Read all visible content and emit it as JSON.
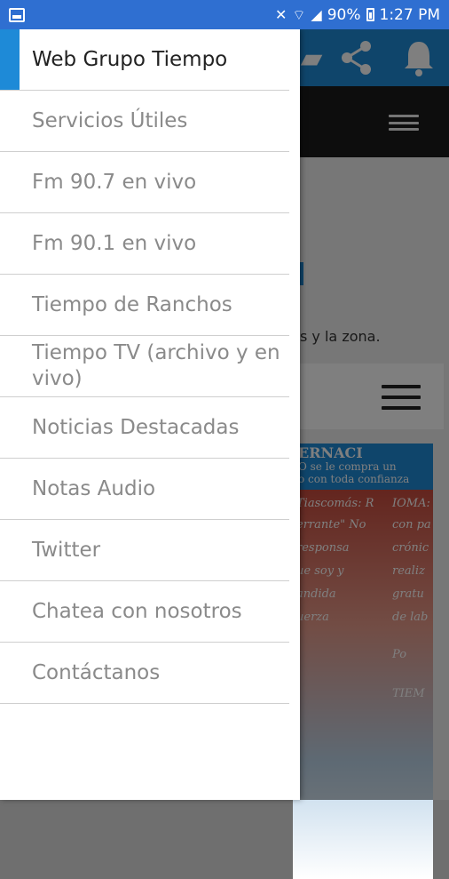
{
  "status_bar": {
    "battery": "90%",
    "time": "1:27 PM",
    "left_icon": "image-icon",
    "icons": [
      "mute-icon",
      "wifi-icon",
      "signal-icon",
      "battery-icon"
    ]
  },
  "app": {
    "topbar_icons": [
      "share-icon",
      "bell-icon"
    ],
    "site_text": "s y la zona."
  },
  "drawer": {
    "items": [
      {
        "label": "Web Grupo Tiempo",
        "active": true
      },
      {
        "label": "Servicios Útiles"
      },
      {
        "label": "Fm 90.7 en vivo"
      },
      {
        "label": "Fm 90.1 en vivo"
      },
      {
        "label": "Tiempo de Ranchos"
      },
      {
        "label": "Tiempo TV (archivo y en vivo)"
      },
      {
        "label": "Noticias Destacadas"
      },
      {
        "label": "Notas Audio"
      },
      {
        "label": "Twitter"
      },
      {
        "label": "Chatea con nosotros"
      },
      {
        "label": "Contáctanos"
      }
    ]
  },
  "newspaper": {
    "header_title": "ERNACI",
    "header_lines": [
      "O se le compra un",
      "o con toda confianza"
    ],
    "body_lines": [
      "Tiascomás: R",
      "IOMA:",
      "errante\" No",
      "con pa",
      "responsa",
      "crónic",
      "ue soy y",
      "realiz",
      "andida",
      "gratu",
      "uerza",
      "de lab",
      "Po",
      "TIEM"
    ]
  },
  "colors": {
    "status_bar": "#2f6fd1",
    "accent": "#1e8ad7",
    "navbar": "#1a1a1a"
  }
}
